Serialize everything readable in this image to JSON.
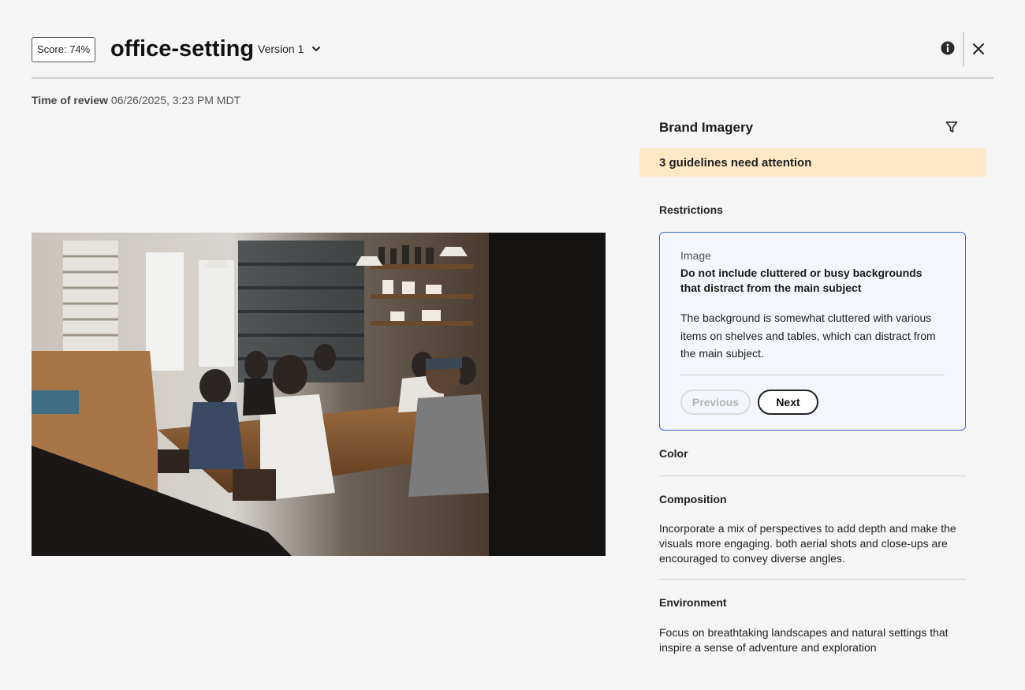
{
  "header": {
    "score": "Score: 74%",
    "title": "office-setting",
    "version": "Version 1"
  },
  "review": {
    "label": "Time of review",
    "value": "06/26/2025, 3:23 PM MDT"
  },
  "panel": {
    "title": "Brand Imagery",
    "attention": "3 guidelines need attention",
    "restrictions": {
      "heading": "Restrictions",
      "card": {
        "category": "Image",
        "rule": "Do not include cluttered or busy backgrounds that distract from the main subject",
        "description": "The background is somewhat cluttered with various items on shelves and tables, which can distract from the main subject.",
        "previous": "Previous",
        "next": "Next"
      }
    },
    "color": {
      "heading": "Color"
    },
    "composition": {
      "heading": "Composition",
      "text": "Incorporate a mix of perspectives to add depth and make the visuals more engaging. both aerial shots and close-ups are encouraged to convey diverse angles."
    },
    "environment": {
      "heading": "Environment",
      "text": "Focus on breathtaking landscapes and natural settings that inspire a sense of adventure and exploration"
    }
  },
  "icons": {
    "info": "info-icon",
    "close": "close-icon",
    "filter": "filter-icon",
    "chevron": "chevron-down-icon"
  },
  "colors": {
    "banner": "#ffe8c5",
    "card_border": "#3b68d4",
    "card_bg": "#f3f6fc"
  }
}
